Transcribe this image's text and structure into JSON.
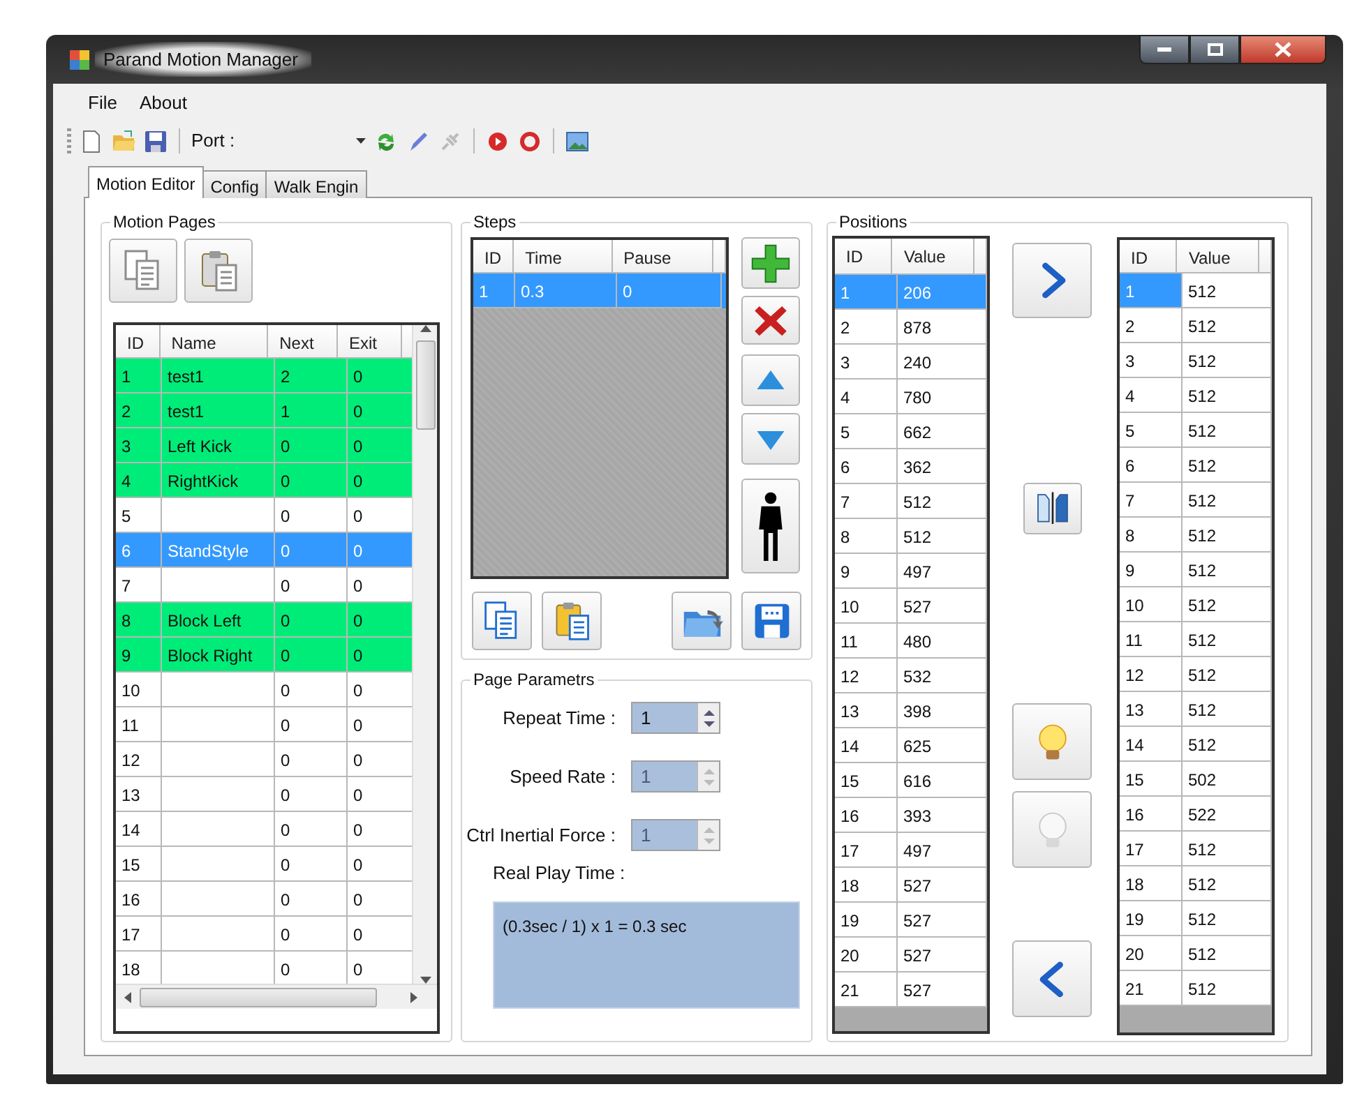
{
  "window": {
    "title": "Parand Motion Manager"
  },
  "menu": [
    {
      "label": "File"
    },
    {
      "label": "About"
    }
  ],
  "toolbar": {
    "port_label": "Port :"
  },
  "tabs": [
    {
      "label": "Motion Editor",
      "selected": true
    },
    {
      "label": "Config",
      "selected": false
    },
    {
      "label": "Walk Engin",
      "selected": false
    }
  ],
  "motion_pages": {
    "title": "Motion Pages",
    "columns": [
      "ID",
      "Name",
      "Next",
      "Exit"
    ],
    "rows": [
      {
        "cells": [
          "1",
          "test1",
          "2",
          "0"
        ],
        "highlighted": true,
        "selected": false
      },
      {
        "cells": [
          "2",
          "test1",
          "1",
          "0"
        ],
        "highlighted": true,
        "selected": false
      },
      {
        "cells": [
          "3",
          "Left Kick",
          "0",
          "0"
        ],
        "highlighted": true,
        "selected": false
      },
      {
        "cells": [
          "4",
          "RightKick",
          "0",
          "0"
        ],
        "highlighted": true,
        "selected": false
      },
      {
        "cells": [
          "5",
          "",
          "0",
          "0"
        ],
        "highlighted": false,
        "selected": false
      },
      {
        "cells": [
          "6",
          "StandStyle",
          "0",
          "0"
        ],
        "highlighted": false,
        "selected": true
      },
      {
        "cells": [
          "7",
          "",
          "0",
          "0"
        ],
        "highlighted": false,
        "selected": false
      },
      {
        "cells": [
          "8",
          "Block Left",
          "0",
          "0"
        ],
        "highlighted": true,
        "selected": false
      },
      {
        "cells": [
          "9",
          "Block Right",
          "0",
          "0"
        ],
        "highlighted": true,
        "selected": false
      },
      {
        "cells": [
          "10",
          "",
          "0",
          "0"
        ],
        "highlighted": false,
        "selected": false
      },
      {
        "cells": [
          "11",
          "",
          "0",
          "0"
        ],
        "highlighted": false,
        "selected": false
      },
      {
        "cells": [
          "12",
          "",
          "0",
          "0"
        ],
        "highlighted": false,
        "selected": false
      },
      {
        "cells": [
          "13",
          "",
          "0",
          "0"
        ],
        "highlighted": false,
        "selected": false
      },
      {
        "cells": [
          "14",
          "",
          "0",
          "0"
        ],
        "highlighted": false,
        "selected": false
      },
      {
        "cells": [
          "15",
          "",
          "0",
          "0"
        ],
        "highlighted": false,
        "selected": false
      },
      {
        "cells": [
          "16",
          "",
          "0",
          "0"
        ],
        "highlighted": false,
        "selected": false
      },
      {
        "cells": [
          "17",
          "",
          "0",
          "0"
        ],
        "highlighted": false,
        "selected": false
      },
      {
        "cells": [
          "18",
          "",
          "0",
          "0"
        ],
        "highlighted": false,
        "selected": false
      }
    ]
  },
  "steps": {
    "title": "Steps",
    "columns": [
      "ID",
      "Time",
      "Pause"
    ],
    "rows": [
      {
        "cells": [
          "1",
          "0.3",
          "0"
        ],
        "selected": true
      }
    ]
  },
  "page_parameters": {
    "title": "Page Parametrs",
    "fields": [
      {
        "label": "Repeat Time :",
        "value": "1",
        "disabled": false
      },
      {
        "label": "Speed Rate :",
        "value": "1",
        "disabled": true
      },
      {
        "label": "Ctrl Inertial Force :",
        "value": "1",
        "disabled": true
      }
    ],
    "real_play_time": {
      "label": "Real Play Time :",
      "value": "(0.3sec / 1) x 1 =  0.3 sec"
    }
  },
  "positions": {
    "title": "Positions",
    "source": {
      "columns": [
        "ID",
        "Value"
      ],
      "rows": [
        {
          "cells": [
            "1",
            "206"
          ],
          "selected": true
        },
        {
          "cells": [
            "2",
            "878"
          ],
          "selected": false
        },
        {
          "cells": [
            "3",
            "240"
          ],
          "selected": false
        },
        {
          "cells": [
            "4",
            "780"
          ],
          "selected": false
        },
        {
          "cells": [
            "5",
            "662"
          ],
          "selected": false
        },
        {
          "cells": [
            "6",
            "362"
          ],
          "selected": false
        },
        {
          "cells": [
            "7",
            "512"
          ],
          "selected": false
        },
        {
          "cells": [
            "8",
            "512"
          ],
          "selected": false
        },
        {
          "cells": [
            "9",
            "497"
          ],
          "selected": false
        },
        {
          "cells": [
            "10",
            "527"
          ],
          "selected": false
        },
        {
          "cells": [
            "11",
            "480"
          ],
          "selected": false
        },
        {
          "cells": [
            "12",
            "532"
          ],
          "selected": false
        },
        {
          "cells": [
            "13",
            "398"
          ],
          "selected": false
        },
        {
          "cells": [
            "14",
            "625"
          ],
          "selected": false
        },
        {
          "cells": [
            "15",
            "616"
          ],
          "selected": false
        },
        {
          "cells": [
            "16",
            "393"
          ],
          "selected": false
        },
        {
          "cells": [
            "17",
            "497"
          ],
          "selected": false
        },
        {
          "cells": [
            "18",
            "527"
          ],
          "selected": false
        },
        {
          "cells": [
            "19",
            "527"
          ],
          "selected": false
        },
        {
          "cells": [
            "20",
            "527"
          ],
          "selected": false
        },
        {
          "cells": [
            "21",
            "527"
          ],
          "selected": false
        }
      ]
    },
    "target": {
      "columns": [
        "ID",
        "Value"
      ],
      "rows": [
        {
          "cells": [
            "1",
            "512"
          ],
          "selected": true
        },
        {
          "cells": [
            "2",
            "512"
          ],
          "selected": false
        },
        {
          "cells": [
            "3",
            "512"
          ],
          "selected": false
        },
        {
          "cells": [
            "4",
            "512"
          ],
          "selected": false
        },
        {
          "cells": [
            "5",
            "512"
          ],
          "selected": false
        },
        {
          "cells": [
            "6",
            "512"
          ],
          "selected": false
        },
        {
          "cells": [
            "7",
            "512"
          ],
          "selected": false
        },
        {
          "cells": [
            "8",
            "512"
          ],
          "selected": false
        },
        {
          "cells": [
            "9",
            "512"
          ],
          "selected": false
        },
        {
          "cells": [
            "10",
            "512"
          ],
          "selected": false
        },
        {
          "cells": [
            "11",
            "512"
          ],
          "selected": false
        },
        {
          "cells": [
            "12",
            "512"
          ],
          "selected": false
        },
        {
          "cells": [
            "13",
            "512"
          ],
          "selected": false
        },
        {
          "cells": [
            "14",
            "512"
          ],
          "selected": false
        },
        {
          "cells": [
            "15",
            "502"
          ],
          "selected": false
        },
        {
          "cells": [
            "16",
            "522"
          ],
          "selected": false
        },
        {
          "cells": [
            "17",
            "512"
          ],
          "selected": false
        },
        {
          "cells": [
            "18",
            "512"
          ],
          "selected": false
        },
        {
          "cells": [
            "19",
            "512"
          ],
          "selected": false
        },
        {
          "cells": [
            "20",
            "512"
          ],
          "selected": false
        },
        {
          "cells": [
            "21",
            "512"
          ],
          "selected": false
        }
      ]
    }
  }
}
